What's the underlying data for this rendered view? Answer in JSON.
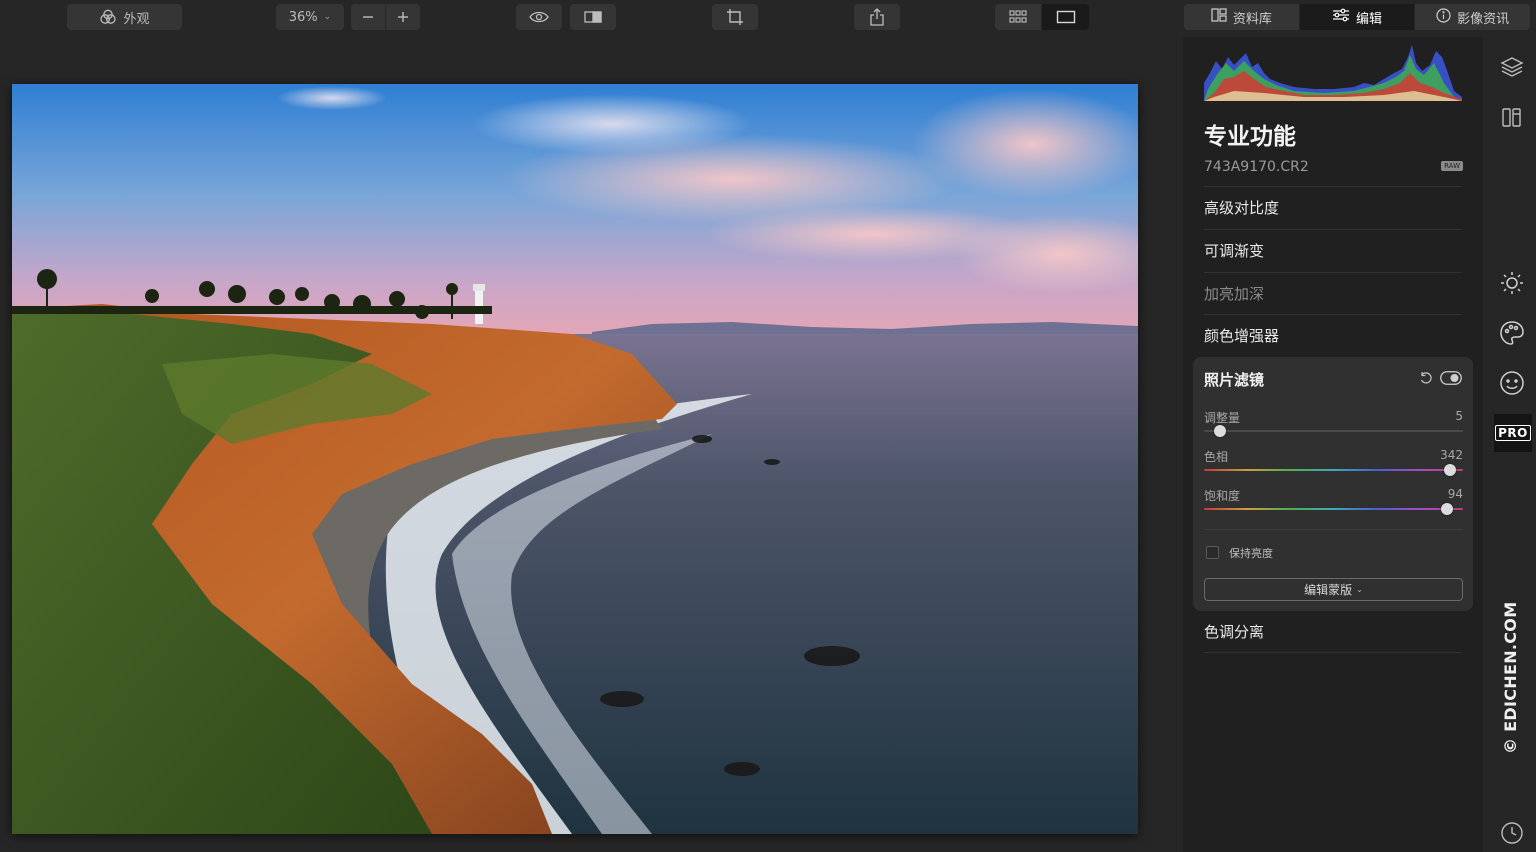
{
  "toolbar": {
    "looks_label": "外观",
    "zoom_value": "36%",
    "zoom_chevron": "⌄",
    "icons": [
      "looks-icon",
      "zoom-out-icon",
      "zoom-in-icon",
      "eye-icon",
      "compare-icon",
      "crop-icon",
      "share-icon",
      "grid-view-icon",
      "single-view-icon"
    ]
  },
  "tabs": [
    {
      "label": "资料库",
      "icon": "library-icon",
      "active": false
    },
    {
      "label": "编辑",
      "icon": "sliders-icon",
      "active": true
    },
    {
      "label": "影像资讯",
      "icon": "info-icon",
      "active": false
    }
  ],
  "panel": {
    "title": "专业功能",
    "file_name": "743A9170.CR2",
    "raw_badge": "RAW",
    "sections": [
      {
        "label": "高级对比度",
        "dim": false
      },
      {
        "label": "可调渐变",
        "dim": false
      },
      {
        "label": "加亮加深",
        "dim": true
      },
      {
        "label": "颜色增强器",
        "dim": false
      }
    ],
    "filter": {
      "title": "照片滤镜",
      "sliders": [
        {
          "label": "调整量",
          "value": "5",
          "fraction": 0.06,
          "type": "plain"
        },
        {
          "label": "色相",
          "value": "342",
          "fraction": 0.95,
          "type": "hue"
        },
        {
          "label": "饱和度",
          "value": "94",
          "fraction": 0.94,
          "type": "hue"
        }
      ],
      "checkbox_label": "保持亮度",
      "mask_button": "编辑蒙版",
      "mask_chevron": "⌄"
    },
    "after_section": "色调分离"
  },
  "rail": {
    "icons": [
      "layers-icon",
      "presets-icon",
      "essentials-icon",
      "creative-icon",
      "portrait-icon",
      "history-icon"
    ],
    "pro_label": "PRO"
  },
  "watermark": "© EDICHEN.COM",
  "colors": {
    "accent_active_tab": "#1b1b1b",
    "panel_bg": "#202020",
    "card_bg": "#303030"
  }
}
